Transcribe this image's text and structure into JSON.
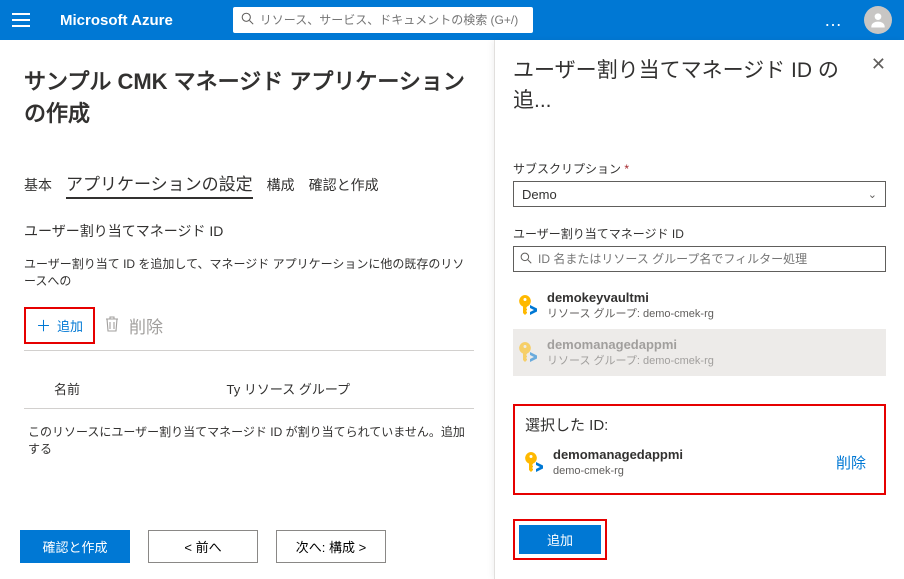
{
  "header": {
    "brand": "Microsoft Azure",
    "search_placeholder": "リソース、サービス、ドキュメントの検索 (G+/)"
  },
  "page": {
    "title": "サンプル CMK マネージド アプリケーションの作成",
    "tabs": {
      "basic": "基本",
      "app_settings": "アプリケーションの設定",
      "config": "構成",
      "review": "確認と作成"
    },
    "section_label": "ユーザー割り当てマネージド ID",
    "description": "ユーザー割り当て ID を追加して、マネージド アプリケーションに他の既存のリソースへの",
    "add_label": "追加",
    "delete_label": "削除",
    "col_name": "名前",
    "col_ty": "Ty",
    "col_rg": "リソース グループ",
    "empty_msg": "このリソースにユーザー割り当てマネージド ID が割り当てられていません。追加する",
    "btn_review": "確認と作成",
    "btn_prev": "< 前へ",
    "btn_next": "次へ: 構成 >"
  },
  "panel": {
    "title": "ユーザー割り当てマネージド ID の追...",
    "sub_label": "サブスクリプション",
    "sub_value": "Demo",
    "mi_label": "ユーザー割り当てマネージド ID",
    "filter_placeholder": "ID 名またはリソース グループ名でフィルター処理",
    "items": [
      {
        "name": "demokeyvaultmi",
        "rg_prefix": "リソース グループ: ",
        "rg": "demo-cmek-rg",
        "selected": false
      },
      {
        "name": "demomanagedappmi",
        "rg_prefix": "リソース グループ: ",
        "rg": "demo-cmek-rg",
        "selected": true
      }
    ],
    "selected_title": "選択した ID:",
    "selected_name": "demomanagedappmi",
    "selected_rg": "demo-cmek-rg",
    "selected_delete": "削除",
    "add_btn": "追加"
  }
}
